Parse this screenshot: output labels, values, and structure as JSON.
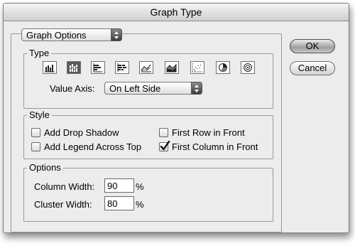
{
  "dialog": {
    "title": "Graph Type"
  },
  "section_popup": {
    "value": "Graph Options"
  },
  "type_group": {
    "title": "Type",
    "icons": [
      {
        "name": "grouped-column-graph-icon",
        "selected": false
      },
      {
        "name": "stacked-column-graph-icon",
        "selected": true
      },
      {
        "name": "grouped-bar-graph-icon",
        "selected": false
      },
      {
        "name": "stacked-bar-graph-icon",
        "selected": false
      },
      {
        "name": "line-graph-icon",
        "selected": false
      },
      {
        "name": "area-graph-icon",
        "selected": false
      },
      {
        "name": "scatter-graph-icon",
        "selected": false
      },
      {
        "name": "pie-graph-icon",
        "selected": false
      },
      {
        "name": "radar-graph-icon",
        "selected": false
      }
    ],
    "value_axis_label": "Value Axis:",
    "value_axis_value": "On Left Side"
  },
  "style_group": {
    "title": "Style",
    "add_drop_shadow": {
      "label": "Add Drop Shadow",
      "checked": false
    },
    "add_legend_across_top": {
      "label": "Add Legend Across Top",
      "checked": false
    },
    "first_row_in_front": {
      "label": "First Row in Front",
      "checked": false
    },
    "first_column_in_front": {
      "label": "First Column in Front",
      "checked": true
    }
  },
  "options_group": {
    "title": "Options",
    "column_width_label": "Column Width:",
    "column_width_value": "90",
    "cluster_width_label": "Cluster Width:",
    "cluster_width_value": "80",
    "unit": "%"
  },
  "buttons": {
    "ok": "OK",
    "cancel": "Cancel"
  }
}
